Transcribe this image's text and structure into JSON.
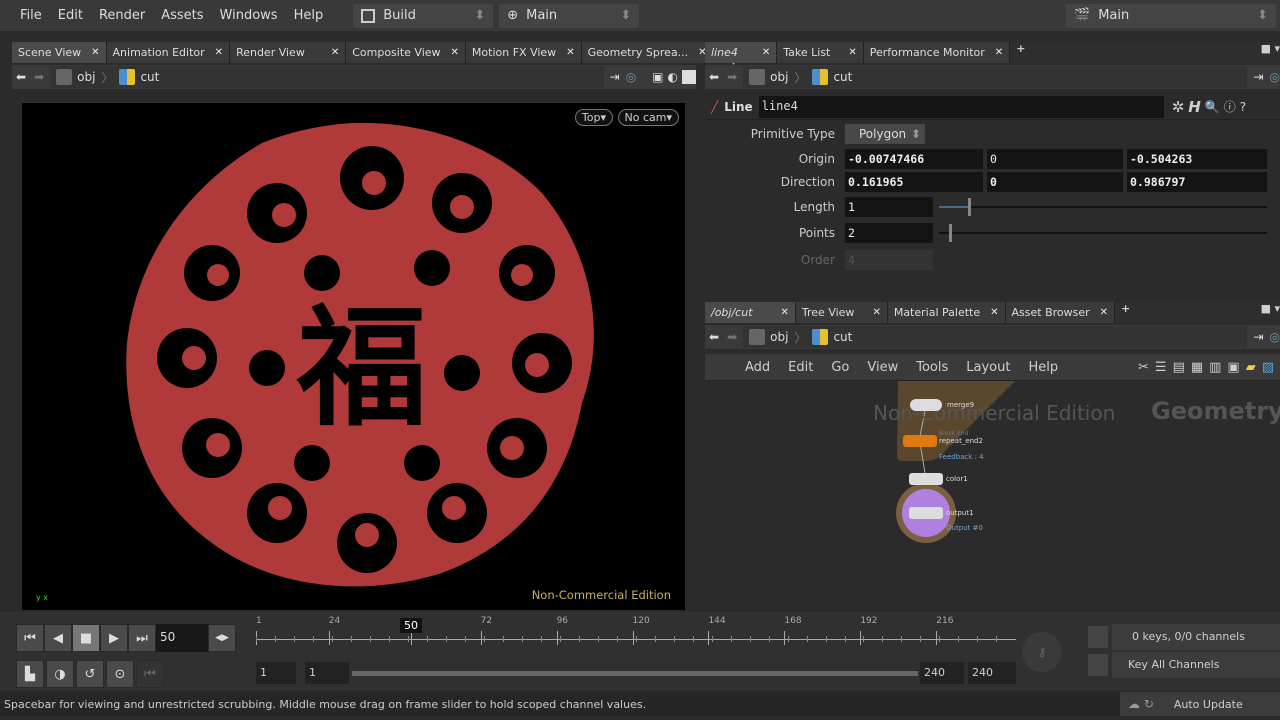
{
  "menu": {
    "items": [
      "File",
      "Edit",
      "Render",
      "Assets",
      "Windows",
      "Help"
    ],
    "desktop": "Build",
    "context": "Main",
    "right_context": "Main"
  },
  "left_pane": {
    "tabs": [
      "Scene View",
      "Animation Editor",
      "Render View",
      "Composite View",
      "Motion FX View",
      "Geometry Sprea..."
    ],
    "path": [
      "obj",
      "cut"
    ],
    "view_buttons": {
      "view": "Top",
      "camera": "No cam"
    },
    "watermark": "Non-Commercial Edition",
    "axis": "y x",
    "glyph": "福",
    "colors": {
      "shape": "#b03a3a",
      "background": "#000000"
    }
  },
  "params_pane": {
    "tabs": [
      "line4",
      "Take List",
      "Performance Monitor"
    ],
    "path": [
      "obj",
      "cut"
    ],
    "node_type": "Line",
    "node_name": "line4",
    "primitive_type": {
      "label": "Primitive Type",
      "value": "Polygon"
    },
    "origin": {
      "label": "Origin",
      "values": [
        "-0.00747466",
        "0",
        "-0.504263"
      ]
    },
    "direction": {
      "label": "Direction",
      "values": [
        "0.161965",
        "0",
        "0.986797"
      ]
    },
    "length": {
      "label": "Length",
      "value": "1"
    },
    "points": {
      "label": "Points",
      "value": "2"
    },
    "order": {
      "label": "Order",
      "value": "4"
    }
  },
  "network_pane": {
    "tabs": [
      "/obj/cut",
      "Tree View",
      "Material Palette",
      "Asset Browser"
    ],
    "path": [
      "obj",
      "cut"
    ],
    "menu": [
      "Add",
      "Edit",
      "Go",
      "View",
      "Tools",
      "Layout",
      "Help"
    ],
    "watermark": "Non-Commercial Edition",
    "context_label": "Geometry",
    "nodes": [
      {
        "name": "merge9"
      },
      {
        "name": "repeat_end2",
        "sub": "Block End",
        "info": "Feedback : 4"
      },
      {
        "name": "color1"
      },
      {
        "name": "output1",
        "info": "Output #0"
      }
    ]
  },
  "timeline": {
    "current_frame": "50",
    "ticks": [
      "1",
      "24",
      "50",
      "72",
      "96",
      "120",
      "144",
      "168",
      "192",
      "216"
    ],
    "range_start": "1",
    "range_start2": "1",
    "range_end": "240",
    "range_end2": "240",
    "keys_info": "0 keys, 0/0 channels",
    "key_all": "Key All Channels"
  },
  "status": {
    "message": "Spacebar for viewing and unrestricted scrubbing. Middle mouse drag on frame slider to hold scoped channel values.",
    "update_mode": "Auto Update"
  }
}
